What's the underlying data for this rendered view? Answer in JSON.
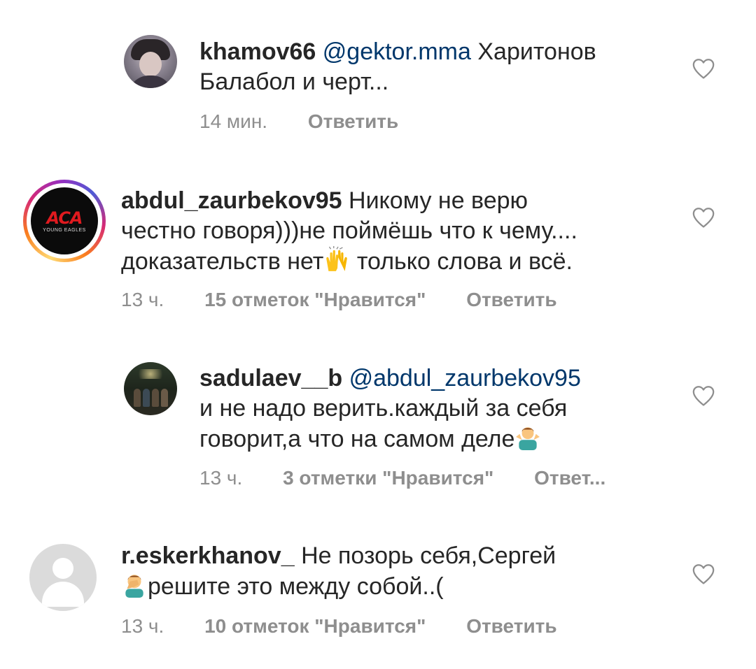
{
  "comments": [
    {
      "username": "khamov66",
      "mention": "@gektor.mma",
      "text_line1": " Харитонов",
      "text_line2": "Балабол и черт...",
      "time": "14 мин.",
      "likes": "",
      "reply": "Ответить"
    },
    {
      "username": "abdul_zaurbekov95",
      "text_line1": " Никому не верю",
      "text_line2": "честно говоря)))не поймёшь что к чему....",
      "text_line3a": "доказательств нет",
      "emoji": "raising-hands-emoji",
      "text_line3b": " только слова и всё.",
      "time": "13 ч.",
      "likes": "15 отметок \"Нравится\"",
      "reply": "Ответить",
      "avatar_logo": "ACA",
      "avatar_sub": "YOUNG EAGLES"
    },
    {
      "username": "sadulaev__b",
      "mention": "@abdul_zaurbekov95",
      "text_line1": "и не надо верить.каждый за себя",
      "text_line2": "говорит,а что на самом деле",
      "emoji": "person-shrugging-emoji",
      "time": "13 ч.",
      "likes": "3 отметки \"Нравится\"",
      "reply": "Ответ..."
    },
    {
      "username": "r.eskerkhanov_",
      "text_line1": " Не позорь себя,Сергей",
      "emoji": "person-facepalming-emoji",
      "text_line2": "решите это между собой..(",
      "time": "13 ч.",
      "likes": "10 отметок \"Нравится\"",
      "reply": "Ответить"
    }
  ],
  "colors": {
    "text": "#262626",
    "mention": "#00376b",
    "meta": "#8e8e8e",
    "aca_red": "#e01a1f"
  },
  "icons": {
    "like": "heart-outline-icon"
  }
}
